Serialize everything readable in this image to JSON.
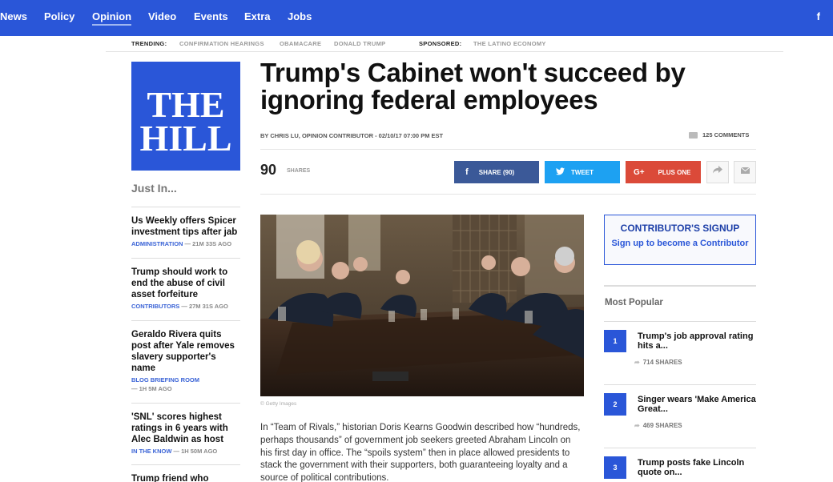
{
  "nav": {
    "items": [
      "News",
      "Policy",
      "Opinion",
      "Video",
      "Events",
      "Extra",
      "Jobs"
    ],
    "active": "Opinion",
    "facebook_glyph": "f"
  },
  "trending": {
    "label": "TRENDING:",
    "links": [
      "CONFIRMATION HEARINGS",
      "OBAMACARE",
      "DONALD TRUMP"
    ],
    "sponsored_label": "SPONSORED:",
    "sponsored_link": "THE LATINO ECONOMY"
  },
  "logo": {
    "line1": "THE",
    "line2": "HILL"
  },
  "just_in": {
    "title": "Just In...",
    "items": [
      {
        "title": "Us Weekly offers Spicer investment tips after jab",
        "category": "ADMINISTRATION",
        "time": " — 21M 33S AGO"
      },
      {
        "title": "Trump should work to end the abuse of civil asset forfeiture",
        "category": "CONTRIBUTORS",
        "time": " — 27M 31S AGO"
      },
      {
        "title": "Geraldo Rivera quits post after Yale removes slavery supporter's name",
        "category": "BLOG BRIEFING ROOM",
        "time": "— 1H 5M AGO"
      },
      {
        "title": "'SNL' scores highest ratings in 6 years with Alec Baldwin as host",
        "category": "IN THE KNOW",
        "time": " — 1H 50M AGO"
      },
      {
        "title": "Trump friend who",
        "category": "",
        "time": ""
      }
    ]
  },
  "article": {
    "headline": "Trump's Cabinet won't succeed by ignoring federal employees",
    "byline": "BY CHRIS LU, OPINION CONTRIBUTOR - 02/10/17 07:00 PM EST",
    "comments": "125 COMMENTS",
    "share_count": "90",
    "share_count_label": "SHARES",
    "share_facebook": "SHARE (90)",
    "share_twitter": "TWEET",
    "share_gplus": "PLUS ONE",
    "photo_credit": "© Getty Images",
    "body": "In “Team of Rivals,” historian Doris Kearns Goodwin described how “hundreds, perhaps thousands” of government job seekers greeted Abraham Lincoln on his first day in office. The “spoils system” then in place allowed presidents to stack the government with their supporters, both guaranteeing loyalty and a source of political contributions."
  },
  "contributor_box": {
    "heading": "CONTRIBUTOR'S SIGNUP",
    "subtext": "Sign up to become a Contributor"
  },
  "most_popular": {
    "title": "Most Popular",
    "items": [
      {
        "rank": "1",
        "title": "Trump's job approval rating hits a...",
        "shares": "714 SHARES"
      },
      {
        "rank": "2",
        "title": "Singer wears 'Make America Great...",
        "shares": "469 SHARES"
      },
      {
        "rank": "3",
        "title": "Trump posts fake Lincoln quote on...",
        "shares": ""
      }
    ]
  },
  "colors": {
    "brand_blue": "#2a56d8",
    "facebook": "#3b5998",
    "twitter": "#1da1f2",
    "gplus": "#db4a39"
  }
}
